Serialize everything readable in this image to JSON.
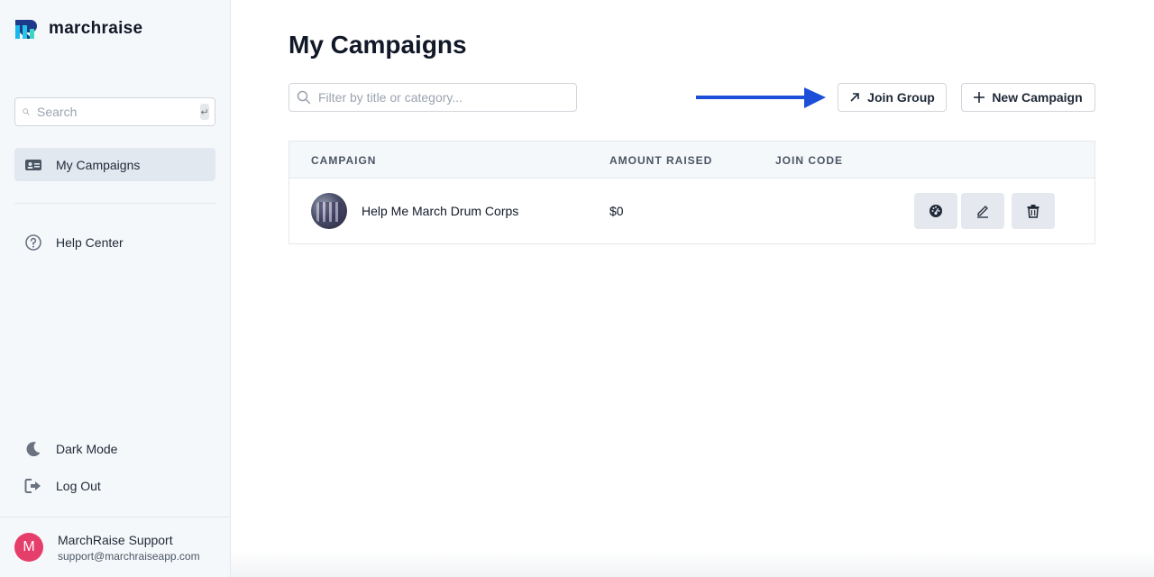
{
  "brand": {
    "name": "marchraise",
    "accent": "#1ab8e8",
    "secondary": "#1e3a8a"
  },
  "sidebar": {
    "search": {
      "placeholder": "Search",
      "shortcut_icon": "enter-key-icon"
    },
    "nav": [
      {
        "label": "My Campaigns",
        "icon": "id-card-icon",
        "active": true
      },
      {
        "label": "Help Center",
        "icon": "question-circle-icon",
        "active": false
      }
    ],
    "bottom": [
      {
        "label": "Dark Mode",
        "icon": "moon-icon"
      },
      {
        "label": "Log Out",
        "icon": "sign-out-icon"
      }
    ],
    "user": {
      "initial": "M",
      "name": "MarchRaise Support",
      "email": "support@marchraiseapp.com",
      "avatar_color": "#e53e6b"
    }
  },
  "main": {
    "title": "My Campaigns",
    "filter": {
      "placeholder": "Filter by title or category..."
    },
    "annotation_arrow_color": "#1d4ed8",
    "buttons": {
      "join": {
        "label": "Join Group",
        "icon": "arrow-up-right-icon"
      },
      "new": {
        "label": "New Campaign",
        "icon": "plus-icon"
      }
    },
    "table": {
      "headers": [
        "CAMPAIGN",
        "AMOUNT RAISED",
        "JOIN CODE"
      ],
      "rows": [
        {
          "title": "Help Me March Drum Corps",
          "amount": "$0",
          "join_code": "",
          "actions": [
            "dashboard-gauge-icon",
            "pencil-icon",
            "trash-icon"
          ]
        }
      ]
    }
  }
}
